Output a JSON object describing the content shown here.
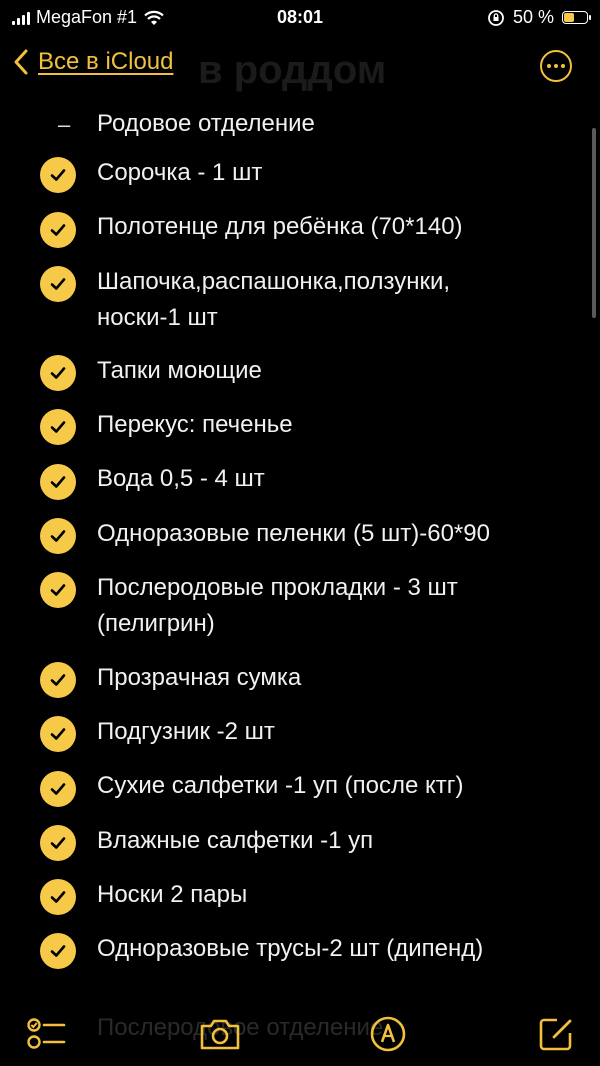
{
  "status_bar": {
    "carrier": "MegaFon #1",
    "time": "08:01",
    "battery_percent": "50 %",
    "battery_level": 0.5,
    "accent_color": "#f7c948"
  },
  "nav": {
    "back_label": "Все в iCloud",
    "ghost_title": "в роддом",
    "more_icon": "ellipsis-circle-icon"
  },
  "list": {
    "section_header": "Родовое отделение",
    "items": [
      "Сорочка - 1 шт",
      "Полотенце для ребёнка (70*140)",
      "Шапочка,распашонка,ползунки,",
      "носки-1 шт",
      "Тапки моющие",
      "Перекус: печенье",
      "Вода 0,5 - 4 шт",
      "Одноразовые пеленки (5 шт)-60*90",
      "Послеродовые прокладки -  3 шт",
      "(пелигрин)",
      "Прозрачная сумка",
      "Подгузник -2 шт",
      "Сухие салфетки -1 уп (после ктг)",
      "Влажные салфетки -1 уп",
      "Носки 2 пары",
      "Одноразовые трусы-2 шт (дипенд)"
    ]
  },
  "toolbar": {
    "ghost_text": "Послеродовое отделение",
    "checklist_icon": "checklist-icon",
    "camera_icon": "camera-icon",
    "markup_icon": "markup-pen-icon",
    "compose_icon": "compose-icon"
  }
}
